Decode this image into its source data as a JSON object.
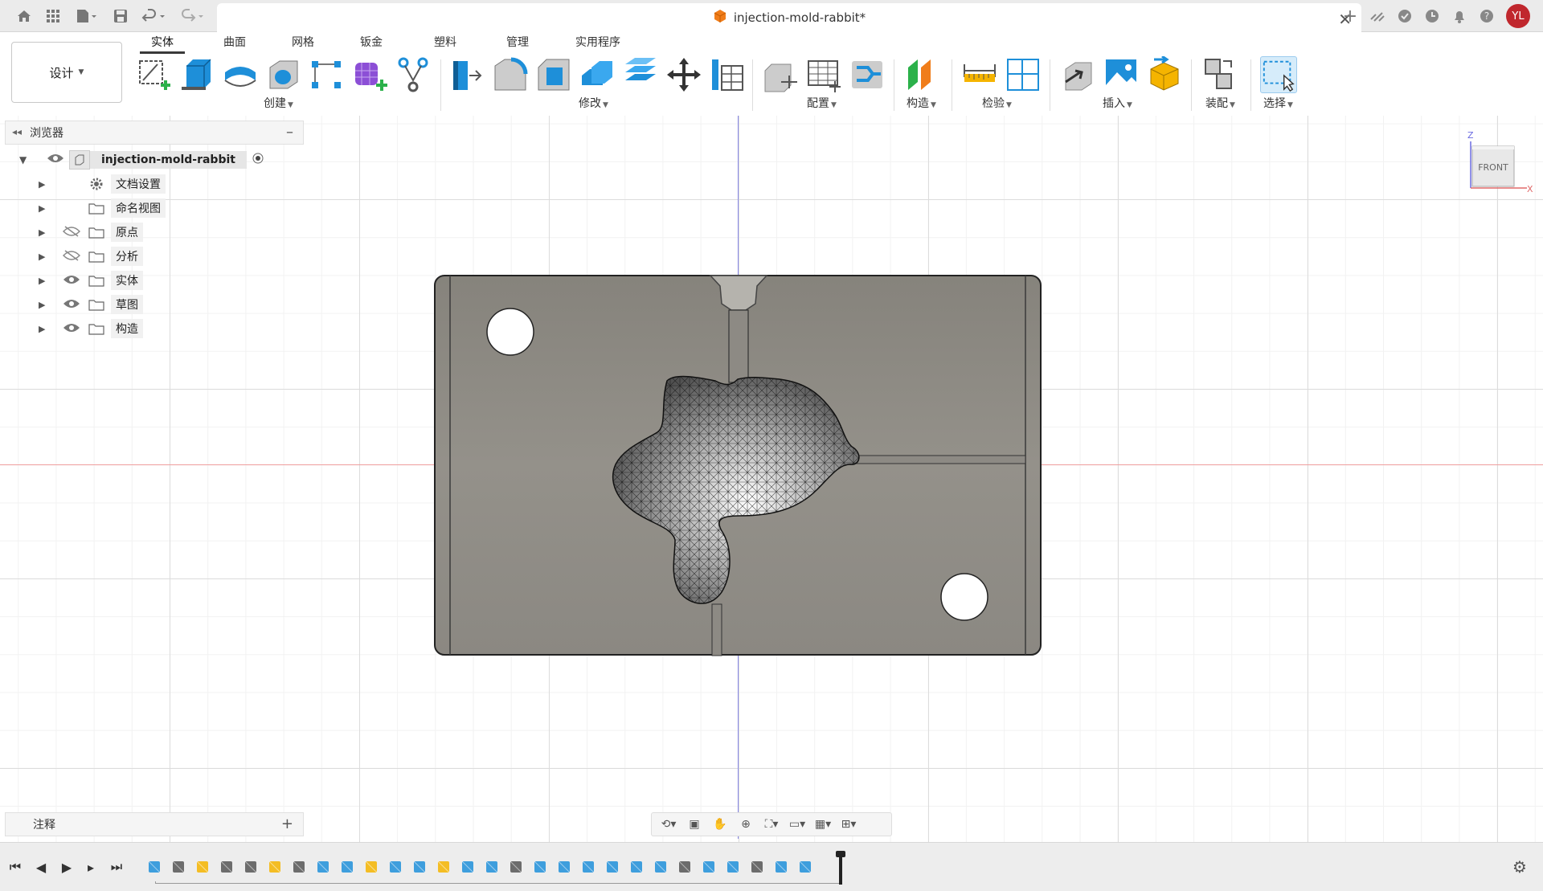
{
  "top_bar": {
    "doc_title": "injection-mold-rabbit*",
    "user_initials": "YL",
    "icons": [
      "home-icon",
      "apps-grid-icon",
      "file-menu-icon",
      "save-icon",
      "undo-icon",
      "redo-icon",
      "new-tab-icon",
      "data-panel-icon",
      "job-status-icon",
      "clock-icon",
      "notifications-icon",
      "help-icon"
    ]
  },
  "workspace": {
    "label": "设计"
  },
  "ribbon": {
    "tabs": [
      "实体",
      "曲面",
      "网格",
      "钣金",
      "塑料",
      "管理",
      "实用程序"
    ],
    "active_tab": "实体",
    "groups": {
      "create": "创建",
      "modify": "修改",
      "configure": "配置",
      "construct": "构造",
      "inspect": "检验",
      "insert": "插入",
      "assemble": "装配",
      "select": "选择"
    }
  },
  "browser": {
    "title": "浏览器",
    "root": "injection-mold-rabbit",
    "items": [
      {
        "label": "文档设置",
        "icon": "gear-icon",
        "eye": "none"
      },
      {
        "label": "命名视图",
        "icon": "folder-icon",
        "eye": "none"
      },
      {
        "label": "原点",
        "icon": "folder-icon",
        "eye": "hidden"
      },
      {
        "label": "分析",
        "icon": "folder-icon",
        "eye": "hidden"
      },
      {
        "label": "实体",
        "icon": "folder-icon",
        "eye": "visible"
      },
      {
        "label": "草图",
        "icon": "folder-icon",
        "eye": "visible"
      },
      {
        "label": "构造",
        "icon": "folder-icon",
        "eye": "visible"
      }
    ]
  },
  "viewcube": {
    "face": "FRONT",
    "axis_z": "Z",
    "axis_x": "X"
  },
  "notes": {
    "title": "注释"
  },
  "colors": {
    "accent": "#0696d7",
    "mold": "#8f8c86",
    "axis_v": "#8a8ae8",
    "axis_h": "#f0a0a0",
    "user_badge": "#c0272d"
  }
}
